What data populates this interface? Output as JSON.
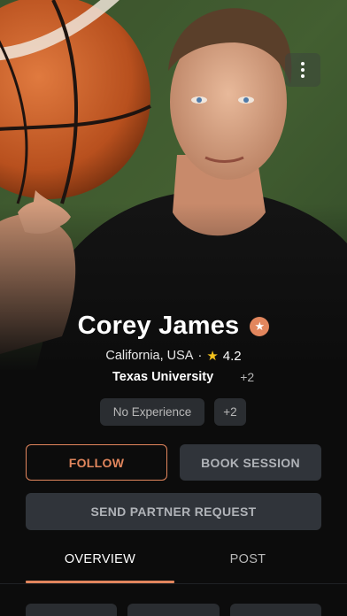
{
  "profile": {
    "name": "Corey James",
    "location": "California, USA",
    "separator": "·",
    "rating": "4.2",
    "school": "Texas University",
    "school_extra": "+2"
  },
  "tags": {
    "experience": "No Experience",
    "extra": "+2"
  },
  "actions": {
    "follow_label": "FOLLOW",
    "book_label": "BOOK SESSION",
    "partner_label": "SEND PARTNER REQUEST"
  },
  "tabs": [
    {
      "label": "OVERVIEW",
      "active": true
    },
    {
      "label": "POST",
      "active": false
    }
  ],
  "icons": {
    "more": "more-vertical-icon",
    "badge": "star-badge-icon",
    "rating": "star-icon"
  },
  "colors": {
    "accent": "#e2865d",
    "star": "#f3c21d",
    "surface": "#30343a",
    "background": "#0c0c0c"
  }
}
